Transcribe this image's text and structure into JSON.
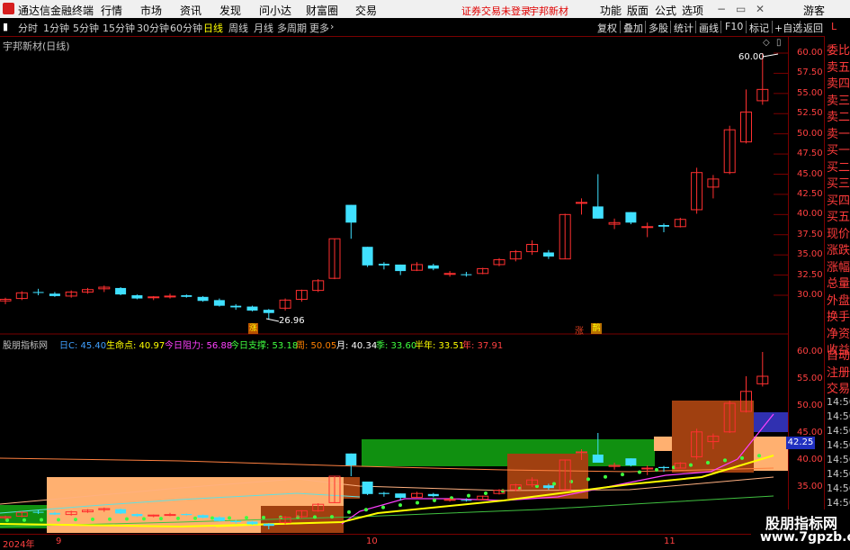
{
  "menubar": {
    "app_title": "通达信金融终端",
    "items": [
      "行情",
      "市场",
      "资讯",
      "发现",
      "问小达",
      "财富圈",
      "交易"
    ],
    "login_status": "证券交易未登录",
    "stock_name": "宇邦新材",
    "right_items": [
      "功能",
      "版面",
      "公式",
      "选项"
    ],
    "guest": "游客"
  },
  "periodbar": {
    "periods": [
      "分时",
      "1分钟",
      "5分钟",
      "15分钟",
      "30分钟",
      "60分钟",
      "日线",
      "周线",
      "月线",
      "多周期",
      "更多"
    ],
    "active": "日线",
    "tools": [
      "复权",
      "叠加",
      "多股",
      "统计",
      "画线",
      "F10",
      "标记",
      "+自选",
      "返回"
    ]
  },
  "main_chart": {
    "title": "宇邦新材(日线)",
    "price_labels": [
      "60.00",
      "57.50",
      "55.00",
      "52.50",
      "50.00",
      "47.50",
      "45.00",
      "42.50",
      "40.00",
      "37.50",
      "35.00",
      "32.50",
      "30.00"
    ],
    "annot_high": "60.00",
    "annot_low": "26.96",
    "badges": [
      {
        "text": "涨",
        "color": "#e04020"
      },
      {
        "text": "涨",
        "color": "#e04020"
      },
      {
        "text": "鹊",
        "color": "#d08000"
      }
    ],
    "candles": [
      [
        29.3,
        29.7,
        28.9,
        29.5
      ],
      [
        29.6,
        30.5,
        29.4,
        30.3
      ],
      [
        30.4,
        30.8,
        30.0,
        30.3
      ],
      [
        30.2,
        30.4,
        29.8,
        29.9
      ],
      [
        29.9,
        30.6,
        29.7,
        30.4
      ],
      [
        30.4,
        30.9,
        30.2,
        30.7
      ],
      [
        30.8,
        31.2,
        30.4,
        31.0
      ],
      [
        30.9,
        31.0,
        30.0,
        30.1
      ],
      [
        30.0,
        30.1,
        29.5,
        29.6
      ],
      [
        29.7,
        29.9,
        29.4,
        29.8
      ],
      [
        29.8,
        30.2,
        29.6,
        29.9
      ],
      [
        30.0,
        30.1,
        29.7,
        29.8
      ],
      [
        29.8,
        29.9,
        29.2,
        29.3
      ],
      [
        29.4,
        29.6,
        28.6,
        28.7
      ],
      [
        28.7,
        28.9,
        28.2,
        28.5
      ],
      [
        28.6,
        28.7,
        28.0,
        28.1
      ],
      [
        28.2,
        28.3,
        26.96,
        27.8
      ],
      [
        28.4,
        29.6,
        28.1,
        29.4
      ],
      [
        29.5,
        30.7,
        29.2,
        30.6
      ],
      [
        30.6,
        32.0,
        30.4,
        31.8
      ],
      [
        32.1,
        37.0,
        32.0,
        37.0
      ],
      [
        41.2,
        41.2,
        37.0,
        39.0
      ],
      [
        36.0,
        36.0,
        33.5,
        33.7
      ],
      [
        33.9,
        34.1,
        33.2,
        33.7
      ],
      [
        33.8,
        33.8,
        32.5,
        33.0
      ],
      [
        33.1,
        34.1,
        33.0,
        33.8
      ],
      [
        33.7,
        33.9,
        33.1,
        33.3
      ],
      [
        32.7,
        33.0,
        32.3,
        32.7
      ],
      [
        32.6,
        32.9,
        32.3,
        32.5
      ],
      [
        32.7,
        33.4,
        32.6,
        33.3
      ],
      [
        33.8,
        34.6,
        33.6,
        34.4
      ],
      [
        34.5,
        35.6,
        34.2,
        35.4
      ],
      [
        35.4,
        36.8,
        35.0,
        36.3
      ],
      [
        35.3,
        35.6,
        34.5,
        34.8
      ],
      [
        34.5,
        40.1,
        34.5,
        40.0
      ],
      [
        41.5,
        42.0,
        40.0,
        41.5
      ],
      [
        41.0,
        45.0,
        39.5,
        39.5
      ],
      [
        38.8,
        39.5,
        38.2,
        39.0
      ],
      [
        40.3,
        40.3,
        38.8,
        39.0
      ],
      [
        38.5,
        39.0,
        37.2,
        38.5
      ],
      [
        38.7,
        38.9,
        37.8,
        38.5
      ],
      [
        38.5,
        39.6,
        38.4,
        39.4
      ],
      [
        40.6,
        45.8,
        40.1,
        45.2
      ],
      [
        43.4,
        44.9,
        42.0,
        44.4
      ],
      [
        45.2,
        51.0,
        45.0,
        50.5
      ],
      [
        49.0,
        55.5,
        48.8,
        52.7
      ],
      [
        54.1,
        60.0,
        53.6,
        55.5
      ]
    ]
  },
  "indicator": {
    "name": "股朋指标网",
    "legend": [
      {
        "text": "日C: 45.40",
        "color": "#40a0ff"
      },
      {
        "text": "生命点: 40.97",
        "color": "#ffff00"
      },
      {
        "text": "今日阻力: 56.88",
        "color": "#ff40ff"
      },
      {
        "text": "今日支撑: 53.18",
        "color": "#40ff40"
      },
      {
        "text": "周: 50.05",
        "color": "#ff8000"
      },
      {
        "text": "月: 40.34",
        "color": "#ffffff"
      },
      {
        "text": "季: 33.60",
        "color": "#40ff40"
      },
      {
        "text": "半年: 33.51",
        "color": "#ffff00"
      },
      {
        "text": "年: 37.91",
        "color": "#ff4040"
      }
    ],
    "price_labels": [
      "60.00",
      "55.00",
      "50.00",
      "45.00",
      "40.00",
      "35.00"
    ],
    "current_tag": "42.25"
  },
  "date_axis": {
    "year": "2024年",
    "months": [
      "9",
      "10",
      "11"
    ]
  },
  "side_panel": {
    "items": [
      "委比",
      "卖五",
      "卖四",
      "卖三",
      "卖二",
      "卖一",
      "买一",
      "买二",
      "买三",
      "买四",
      "买五",
      "现价",
      "涨跌",
      "涨幅",
      "总量",
      "外盘",
      "换手",
      "净资",
      "收益"
    ],
    "lower_items": [
      "自动",
      "注册",
      "交易"
    ],
    "times": [
      "14:56",
      "14:56",
      "14:56",
      "14:56",
      "14:56",
      "14:56",
      "14:56",
      "14:56"
    ]
  },
  "watermark": {
    "line1": "股朋指标网",
    "line2": "www.7gpzb.com"
  }
}
